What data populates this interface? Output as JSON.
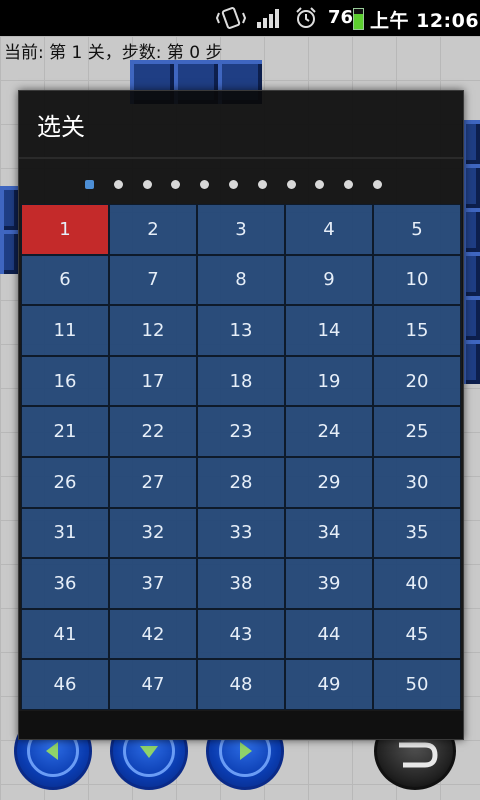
{
  "status_bar": {
    "battery": "76",
    "battery_level": 0.76,
    "time": "上午 12:06",
    "icons": [
      "vibrate-icon",
      "signal-icon",
      "alarm-icon",
      "battery-icon"
    ]
  },
  "game": {
    "status_text": "当前: 第 1 关，步数: 第 0 步"
  },
  "dialog": {
    "title": "选关",
    "page_count": 11,
    "active_page": 0,
    "levels": [
      "1",
      "2",
      "3",
      "4",
      "5",
      "6",
      "7",
      "8",
      "9",
      "10",
      "11",
      "12",
      "13",
      "14",
      "15",
      "16",
      "17",
      "18",
      "19",
      "20",
      "21",
      "22",
      "23",
      "24",
      "25",
      "26",
      "27",
      "28",
      "29",
      "30",
      "31",
      "32",
      "33",
      "34",
      "35",
      "36",
      "37",
      "38",
      "39",
      "40",
      "41",
      "42",
      "43",
      "44",
      "45",
      "46",
      "47",
      "48",
      "49",
      "50"
    ],
    "selected_level": "1"
  },
  "controls": [
    "left-arrow-icon",
    "down-arrow-icon",
    "right-arrow-icon",
    "undo-icon"
  ],
  "colors": {
    "selected": "#c42a2a",
    "cell": "#3060a0",
    "active_dot": "#4d8fd6",
    "wall": "#1f3e84"
  }
}
